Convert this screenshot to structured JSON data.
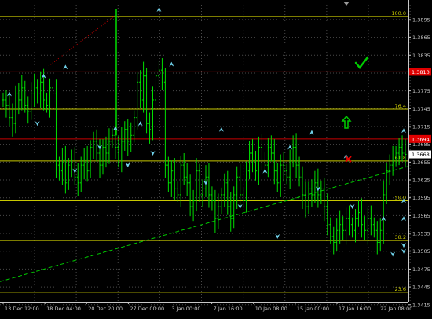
{
  "colors": {
    "background": "#000000",
    "candle": "#00e000",
    "grid": "#4a4a4a",
    "fib_line": "#c8c800",
    "trendline": "#00c800",
    "red_level": "#c80000",
    "fractal_arrow": "#6fd0e8",
    "axis_text": "#c8c8c8",
    "price_box_red": "#e00000",
    "check": "#00cc00",
    "cross": "#e00000"
  },
  "icons": {
    "target": "checkmark-icon",
    "stop": "cross-icon",
    "signal": "up-arrow-icon",
    "scroll": "triangle-down-icon"
  },
  "chart_data": {
    "type": "candlestick",
    "ylim": [
      1.342,
      1.392
    ],
    "y_ticks": [
      "1.3895",
      "1.3865",
      "1.3835",
      "1.3805",
      "1.3775",
      "1.3745",
      "1.3715",
      "1.3685",
      "1.3655",
      "1.3625",
      "1.3595",
      "1.3565",
      "1.3535",
      "1.3505",
      "1.3475",
      "1.3445",
      "1.3415"
    ],
    "x_ticks": [
      "13 Dec 12:00",
      "18 Dec 04:00",
      "20 Dec 20:00",
      "27 Dec 00:00",
      "3 Jan 00:00",
      "7 Jan 16:00",
      "10 Jan 08:00",
      "15 Jan 00:00",
      "17 Jan 16:00",
      "22 Jan 08:00"
    ],
    "fib_levels": [
      {
        "label": "100.0",
        "price": 1.39
      },
      {
        "label": "76.4",
        "price": 1.3744
      },
      {
        "label": "61.8",
        "price": 1.3657
      },
      {
        "label": "50.0",
        "price": 1.359
      },
      {
        "label": "38.2",
        "price": 1.3523
      },
      {
        "label": "23.6",
        "price": 1.3436
      }
    ],
    "red_levels": [
      {
        "label": "1.3810",
        "price": 1.3807
      },
      {
        "label": "1.3694",
        "price": 1.3694
      }
    ],
    "current_price": "1.3668",
    "trendline": {
      "x": [
        0.0,
        1.0
      ],
      "price": [
        1.3454,
        1.3648
      ]
    },
    "close_series": [
      1.376,
      1.375,
      1.373,
      1.372,
      1.377,
      1.376,
      1.378,
      1.375,
      1.374,
      1.377,
      1.378,
      1.377,
      1.379,
      1.376,
      1.375,
      1.378,
      1.377,
      1.365,
      1.364,
      1.366,
      1.362,
      1.365,
      1.366,
      1.363,
      1.362,
      1.365,
      1.366,
      1.364,
      1.368,
      1.369,
      1.367,
      1.365,
      1.368,
      1.367,
      1.369,
      1.37,
      1.368,
      1.366,
      1.369,
      1.371,
      1.369,
      1.37,
      1.373,
      1.379,
      1.376,
      1.38,
      1.372,
      1.371,
      1.376,
      1.38,
      1.381,
      1.379,
      1.365,
      1.362,
      1.364,
      1.361,
      1.36,
      1.365,
      1.363,
      1.362,
      1.358,
      1.359,
      1.364,
      1.36,
      1.361,
      1.363,
      1.36,
      1.359,
      1.356,
      1.358,
      1.36,
      1.362,
      1.358,
      1.356,
      1.36,
      1.363,
      1.36,
      1.359,
      1.364,
      1.367,
      1.366,
      1.364,
      1.368,
      1.366,
      1.365,
      1.368,
      1.367,
      1.364,
      1.362,
      1.365,
      1.364,
      1.363,
      1.366,
      1.368,
      1.365,
      1.363,
      1.36,
      1.358,
      1.361,
      1.36,
      1.362,
      1.36,
      1.361,
      1.358,
      1.355,
      1.353,
      1.352,
      1.354,
      1.355,
      1.354,
      1.356,
      1.355,
      1.354,
      1.356,
      1.357,
      1.355,
      1.354,
      1.356,
      1.355,
      1.354,
      1.352,
      1.354,
      1.36,
      1.364,
      1.365,
      1.366,
      1.367,
      1.368,
      1.367,
      1.3668
    ],
    "fractal_up": [
      {
        "i": 2,
        "price": 1.377
      },
      {
        "i": 13,
        "price": 1.38
      },
      {
        "i": 20,
        "price": 1.3815
      },
      {
        "i": 36,
        "price": 1.3712
      },
      {
        "i": 44,
        "price": 1.372
      },
      {
        "i": 50,
        "price": 1.3912
      },
      {
        "i": 54,
        "price": 1.382
      },
      {
        "i": 70,
        "price": 1.371
      },
      {
        "i": 84,
        "price": 1.364
      },
      {
        "i": 92,
        "price": 1.368
      },
      {
        "i": 99,
        "price": 1.3705
      },
      {
        "i": 110,
        "price": 1.3665
      },
      {
        "i": 122,
        "price": 1.356
      },
      {
        "i": 130,
        "price": 1.356
      },
      {
        "i": 139,
        "price": 1.359
      },
      {
        "i": 147,
        "price": 1.3708
      }
    ],
    "fractal_down": [
      {
        "i": 11,
        "price": 1.372
      },
      {
        "i": 23,
        "price": 1.364
      },
      {
        "i": 31,
        "price": 1.368
      },
      {
        "i": 40,
        "price": 1.365
      },
      {
        "i": 48,
        "price": 1.367
      },
      {
        "i": 65,
        "price": 1.362
      },
      {
        "i": 76,
        "price": 1.358
      },
      {
        "i": 88,
        "price": 1.353
      },
      {
        "i": 101,
        "price": 1.361
      },
      {
        "i": 112,
        "price": 1.358
      },
      {
        "i": 125,
        "price": 1.35
      },
      {
        "i": 134,
        "price": 1.3505
      },
      {
        "i": 141,
        "price": 1.3515
      }
    ]
  }
}
